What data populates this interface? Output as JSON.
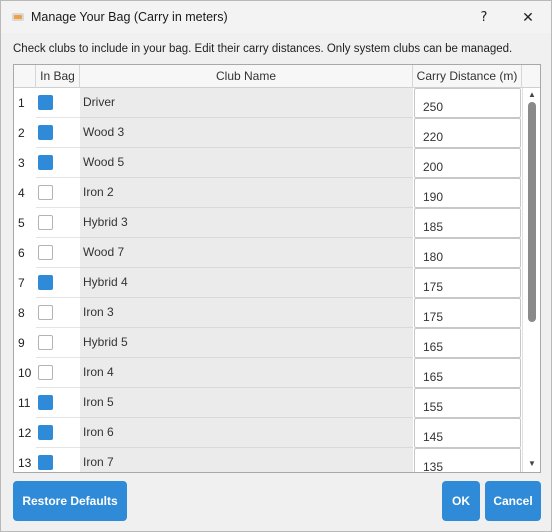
{
  "window": {
    "title": "Manage Your Bag (Carry in meters)",
    "help_label": "?",
    "close_label": "✕"
  },
  "instructions": "Check clubs to include in your bag. Edit their carry distances. Only system clubs can be managed.",
  "table": {
    "columns": [
      "In Bag",
      "Club Name",
      "Carry Distance (m)"
    ],
    "rows": [
      {
        "num": "1",
        "in_bag": true,
        "name": "Driver",
        "carry": "250"
      },
      {
        "num": "2",
        "in_bag": true,
        "name": "Wood 3",
        "carry": "220"
      },
      {
        "num": "3",
        "in_bag": true,
        "name": "Wood 5",
        "carry": "200"
      },
      {
        "num": "4",
        "in_bag": false,
        "name": "Iron 2",
        "carry": "190"
      },
      {
        "num": "5",
        "in_bag": false,
        "name": "Hybrid 3",
        "carry": "185"
      },
      {
        "num": "6",
        "in_bag": false,
        "name": "Wood 7",
        "carry": "180"
      },
      {
        "num": "7",
        "in_bag": true,
        "name": "Hybrid 4",
        "carry": "175"
      },
      {
        "num": "8",
        "in_bag": false,
        "name": "Iron 3",
        "carry": "175"
      },
      {
        "num": "9",
        "in_bag": false,
        "name": "Hybrid 5",
        "carry": "165"
      },
      {
        "num": "10",
        "in_bag": false,
        "name": "Iron 4",
        "carry": "165"
      },
      {
        "num": "11",
        "in_bag": true,
        "name": "Iron 5",
        "carry": "155"
      },
      {
        "num": "12",
        "in_bag": true,
        "name": "Iron 6",
        "carry": "145"
      },
      {
        "num": "13",
        "in_bag": true,
        "name": "Iron 7",
        "carry": "135"
      }
    ]
  },
  "buttons": {
    "restore": "Restore Defaults",
    "ok": "OK",
    "cancel": "Cancel"
  },
  "colors": {
    "accent": "#2f8ad8",
    "name_cell_bg": "#ebebeb"
  },
  "icons": {
    "app": "app-icon",
    "help": "help-icon",
    "close": "close-icon",
    "scroll_up": "scroll-up-arrow-icon",
    "scroll_down": "scroll-down-arrow-icon"
  }
}
